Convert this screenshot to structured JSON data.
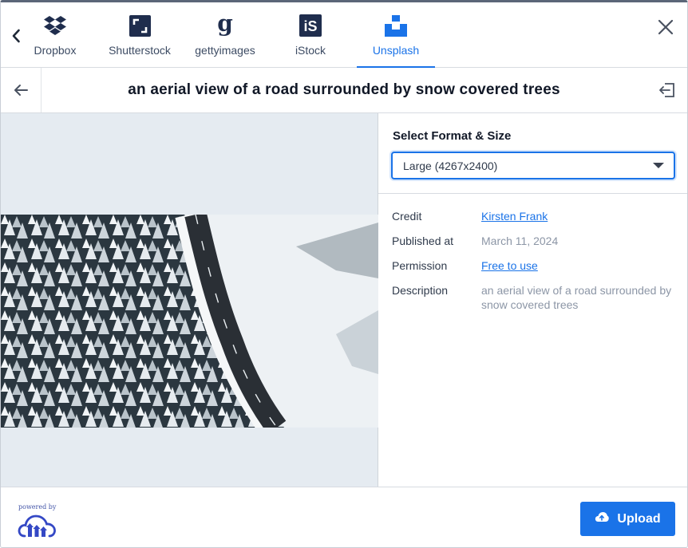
{
  "sources": {
    "tabs": [
      {
        "label": "Dropbox",
        "icon": "dropbox-icon"
      },
      {
        "label": "Shutterstock",
        "icon": "shutterstock-icon"
      },
      {
        "label": "gettyimages",
        "icon": "gettyimages-icon"
      },
      {
        "label": "iStock",
        "icon": "istock-icon"
      },
      {
        "label": "Unsplash",
        "icon": "unsplash-icon"
      }
    ],
    "active": "Unsplash"
  },
  "header": {
    "title": "an aerial view of a road surrounded by snow covered trees"
  },
  "format": {
    "heading": "Select Format & Size",
    "selected": "Large (4267x2400)"
  },
  "details": {
    "credit_label": "Credit",
    "credit_value": "Kirsten Frank",
    "published_label": "Published at",
    "published_value": "March 11, 2024",
    "permission_label": "Permission",
    "permission_value": "Free to use",
    "description_label": "Description",
    "description_value": "an aerial view of a road surrounded by snow covered trees"
  },
  "footer": {
    "powered_by": "powered by",
    "upload_label": "Upload"
  },
  "colors": {
    "accent": "#1a73e8",
    "brand_navy": "#1f2d4d",
    "preview_bg": "#e5ebf1"
  }
}
